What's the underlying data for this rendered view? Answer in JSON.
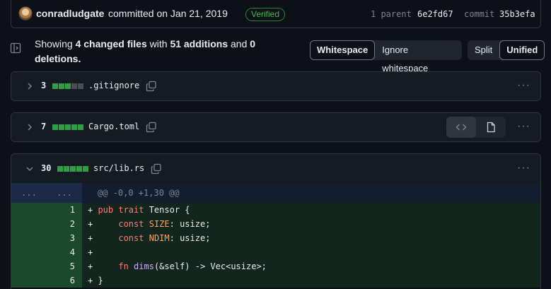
{
  "commit": {
    "author": "conradludgate",
    "committed_text": "committed on Jan 21, 2019",
    "verified_label": "Verified",
    "parent_label": "1 parent",
    "parent_sha": "6e2fd67",
    "commit_label": "commit",
    "commit_sha": "35b3efa"
  },
  "summary": {
    "showing": "Showing",
    "changed_files": "4 changed files",
    "with": "with",
    "additions": "51 additions",
    "and": "and",
    "deletions": "0 deletions."
  },
  "whitespace_toggle": {
    "whitespace": "Whitespace",
    "ignore": "Ignore whitespace",
    "selected": "Whitespace"
  },
  "view_toggle": {
    "split": "Split",
    "unified": "Unified",
    "selected": "Unified"
  },
  "files": [
    {
      "count": "3",
      "name": ".gitignore",
      "blocks_green": 3,
      "blocks_gray": 2,
      "expanded": false
    },
    {
      "count": "7",
      "name": "Cargo.toml",
      "blocks_green": 5,
      "blocks_gray": 0,
      "expanded": false
    },
    {
      "count": "30",
      "name": "src/lib.rs",
      "blocks_green": 5,
      "blocks_gray": 0,
      "expanded": true
    }
  ],
  "more_label": "···",
  "diff": {
    "hunk_old_dots": "...",
    "hunk_new_dots": "...",
    "hunk_header": "@@ -0,0 +1,30 @@",
    "lines": [
      {
        "num": "1",
        "prefix": "+ ",
        "text": "pub trait Tensor {"
      },
      {
        "num": "2",
        "prefix": "+ ",
        "text": "    const SIZE: usize;"
      },
      {
        "num": "3",
        "prefix": "+ ",
        "text": "    const NDIM: usize;"
      },
      {
        "num": "4",
        "prefix": "+ ",
        "text": ""
      },
      {
        "num": "5",
        "prefix": "+ ",
        "text": "    fn dims(&self) -> Vec<usize>;"
      },
      {
        "num": "6",
        "prefix": "+ ",
        "text": "}"
      }
    ]
  }
}
